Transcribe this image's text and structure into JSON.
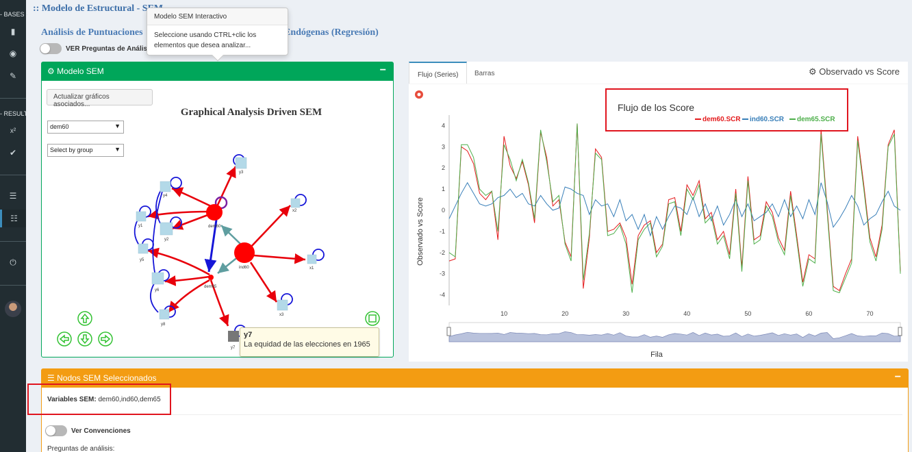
{
  "sidebar": {
    "bases_label": "- BASES -",
    "results_label": "- RESULT",
    "top_items": [
      {
        "icon": "book-icon",
        "glyph": "▮"
      },
      {
        "icon": "database-icon",
        "glyph": "◉"
      },
      {
        "icon": "edit-icon",
        "glyph": "✎"
      }
    ],
    "result_items": [
      {
        "icon": "superscript-icon",
        "glyph": "x²"
      },
      {
        "icon": "check-circle-icon",
        "glyph": "✔"
      }
    ],
    "list_icon_glyph": "☰",
    "sitemap_icon_glyph": "☷",
    "power_icon_glyph": "⏻"
  },
  "header": {
    "title": ":: Modelo de Estructural - SEM",
    "subtitle_start": "Análisis de Puntuaciones",
    "subtitle_end": "Endógenas (Regresión)",
    "ver_preguntas_label": "VER Preguntas de Análisis"
  },
  "popover": {
    "title": "Modelo SEM Interactivo",
    "body": "Seleccione usando CTRL+clic los elementos que desea analizar..."
  },
  "sem_panel": {
    "title": "Modelo SEM",
    "minimize_label": "−",
    "update_button": "Actualizar gráficos asociados...",
    "graph_title": "Graphical Analysis Driven SEM",
    "select_variable": "dem60",
    "select_group": "Select by group",
    "nodes": {
      "dem60": "dem60",
      "ind60": "ind60",
      "dem65": "dem65",
      "x1": "x1",
      "x2": "x2",
      "x3": "x3",
      "y1": "y1",
      "y2": "y2",
      "y3": "y3",
      "y4": "y4",
      "y5": "y5",
      "y6": "y6",
      "y7": "y7",
      "y8": "y8"
    },
    "tooltip": {
      "name": "y7",
      "description": "La equidad de las elecciones en 1965"
    }
  },
  "chart_panel": {
    "tabs": [
      "Flujo (Series)",
      "Barras"
    ],
    "active_tab": 0,
    "caption": "Observado vs Score",
    "gear_icon": "gear-icon"
  },
  "chart_data": {
    "type": "line",
    "title": "Flujo de los Score",
    "xlabel": "Fila",
    "ylabel": "Observado vs Score",
    "xlim": [
      1,
      75
    ],
    "ylim": [
      -4.5,
      4.5
    ],
    "x_ticks": [
      "10",
      "20",
      "30",
      "40",
      "50",
      "60",
      "70"
    ],
    "y_ticks": [
      "4",
      "3",
      "2",
      "1",
      "0",
      "-1",
      "-2",
      "-3",
      "-4"
    ],
    "legend_position": "top-center",
    "grid": false,
    "has_range_slider": true,
    "series": [
      {
        "name": "dem60.SCR",
        "color": "#e41a1c",
        "values": [
          -2.4,
          -2.3,
          3,
          2.8,
          2.2,
          0.8,
          0.5,
          0.9,
          -1.4,
          3.5,
          2.1,
          1.5,
          2.3,
          1.2,
          -0.6,
          3.7,
          2.5,
          0.2,
          0.5,
          -1.5,
          -2.2,
          4.1,
          -3.7,
          -1.3,
          2.9,
          2.5,
          -1,
          -0.9,
          -0.6,
          -1.3,
          -3.5,
          -1.2,
          -0.7,
          -0.5,
          -2,
          -1.6,
          0.5,
          0.6,
          -1,
          1.2,
          0.7,
          1.4,
          -0.4,
          -0.1,
          -1.4,
          -1,
          -2.1,
          1,
          -2.7,
          1.6,
          -1.4,
          -1.2,
          0.4,
          -0.1,
          -1.3,
          -1.9,
          0.9,
          -1.2,
          -3.4,
          -2.1,
          -2.3,
          3.8,
          0.1,
          -3.6,
          -3.8,
          -3,
          -2.3,
          3.5,
          1.2,
          -1.3,
          -2.2,
          -0.7,
          3.1,
          3.8,
          -2.9
        ]
      },
      {
        "name": "ind60.SCR",
        "color": "#377eb8",
        "values": [
          -0.4,
          0.2,
          0.8,
          1.3,
          0.8,
          0.3,
          0.2,
          0.3,
          0.6,
          0.7,
          1,
          0.6,
          0.8,
          0.3,
          0.2,
          0.7,
          0.3,
          0,
          0.1,
          1.1,
          1,
          0.8,
          0.7,
          -0.2,
          0.5,
          0.2,
          0.3,
          -0.3,
          0.5,
          -0.5,
          -0.2,
          -0.9,
          -0.2,
          -1.2,
          -0.3,
          -0.9,
          -0.3,
          0.2,
          0.1,
          -0.2,
          0.6,
          -0.3,
          0.3,
          -0.5,
          0.2,
          -0.7,
          -0.2,
          0.5,
          -0.3,
          0.3,
          -0.5,
          -0.3,
          -0.1,
          0.3,
          -0.3,
          0.5,
          -0.3,
          0.2,
          -0.4,
          0.5,
          -0.2,
          1.3,
          0.4,
          -0.8,
          -0.4,
          0.1,
          0.7,
          0.2,
          -0.7,
          -0.4,
          -0.2,
          0.4,
          0.9,
          0.2,
          0
        ]
      },
      {
        "name": "dem65.SCR",
        "color": "#4daf4a",
        "values": [
          -2,
          -2.2,
          3.1,
          3.1,
          2.5,
          1,
          0.7,
          0.9,
          -1,
          3.1,
          2.4,
          1.4,
          2.4,
          1.3,
          -0.4,
          3.8,
          2.3,
          0.4,
          0.7,
          -1.6,
          -2.4,
          4.1,
          -3.3,
          -1.1,
          2.7,
          2.4,
          -1.2,
          -1.1,
          -0.7,
          -1.6,
          -3.9,
          -1.4,
          -0.9,
          -0.6,
          -2.2,
          -1.7,
          0.3,
          0.4,
          -1.2,
          1,
          0.5,
          1.2,
          -0.6,
          -0.3,
          -1.6,
          -1.2,
          -2.3,
          0.8,
          -2.9,
          1.4,
          -1.6,
          -1.4,
          0.2,
          -0.3,
          -1.5,
          -2.1,
          0.7,
          -1.4,
          -3.6,
          -2.3,
          -2.5,
          3.6,
          -0.1,
          -3.8,
          -3.9,
          -3.2,
          -2.5,
          3.3,
          1,
          -1.5,
          -2.4,
          -0.9,
          3,
          3.6,
          -3
        ]
      }
    ]
  },
  "nodes_panel": {
    "title": "Nodos SEM Seleccionados",
    "minimize_label": "−",
    "vars_label": "Variables SEM:",
    "vars_value": "dem60,ind60,dem65",
    "ver_convenciones_label": "Ver Convenciones",
    "preguntas_label": "Preguntas de análisis:"
  }
}
